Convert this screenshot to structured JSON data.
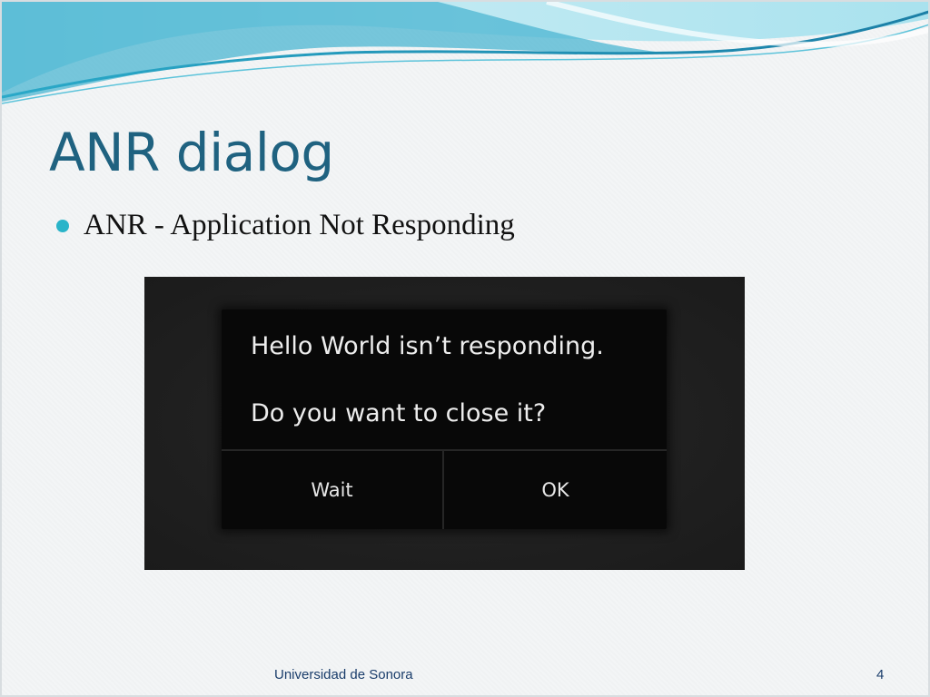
{
  "slide": {
    "title": "ANR dialog",
    "bullets": [
      "ANR - Application Not Responding"
    ],
    "footer_text": "Universidad de Sonora",
    "page_number": "4"
  },
  "screenshot": {
    "message_line1": "Hello World isn’t responding.",
    "message_line2": "Do you want to close it?",
    "buttons": {
      "wait_label": "Wait",
      "ok_label": "OK"
    }
  },
  "colors": {
    "title": "#1f6280",
    "bullet": "#2ab4c9",
    "wave_dark": "#1b7fa6",
    "wave_light": "#7fd3e6",
    "dialog_bg": "#080808",
    "footer": "#1a3d6b"
  }
}
